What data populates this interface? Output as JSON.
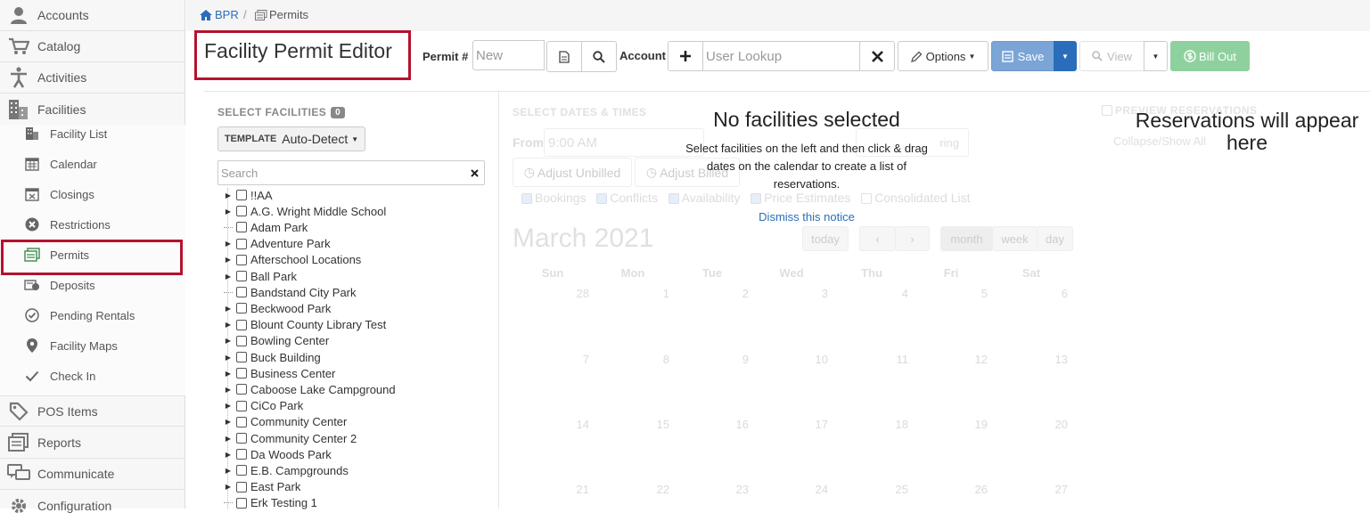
{
  "sidebar": {
    "main_items": [
      {
        "label": "Accounts",
        "icon": "user-icon"
      },
      {
        "label": "Catalog",
        "icon": "cart-icon"
      },
      {
        "label": "Activities",
        "icon": "person-icon"
      },
      {
        "label": "Facilities",
        "icon": "building-icon"
      }
    ],
    "sub_items": [
      {
        "label": "Facility List",
        "icon": "building-small-icon"
      },
      {
        "label": "Calendar",
        "icon": "calendar-icon"
      },
      {
        "label": "Closings",
        "icon": "calendar-x-icon"
      },
      {
        "label": "Restrictions",
        "icon": "x-circle-icon"
      },
      {
        "label": "Permits",
        "icon": "permit-icon"
      },
      {
        "label": "Deposits",
        "icon": "deposit-icon"
      },
      {
        "label": "Pending Rentals",
        "icon": "check-circle-icon"
      },
      {
        "label": "Facility Maps",
        "icon": "map-pin-icon"
      },
      {
        "label": "Check In",
        "icon": "check-icon"
      }
    ],
    "bottom_items": [
      {
        "label": "POS Items",
        "icon": "tag-icon"
      },
      {
        "label": "Reports",
        "icon": "report-icon"
      },
      {
        "label": "Communicate",
        "icon": "chat-icon"
      },
      {
        "label": "Configuration",
        "icon": "gear-icon"
      }
    ]
  },
  "breadcrumb": {
    "home": "BPR",
    "separator": "/",
    "current": "Permits"
  },
  "header": {
    "title": "Facility Permit Editor",
    "permit_label": "Permit #",
    "permit_placeholder": "New",
    "account_label": "Account",
    "account_placeholder": "User Lookup",
    "options_label": "Options",
    "save_label": "Save",
    "view_label": "View",
    "bill_out_label": "Bill Out"
  },
  "facilities": {
    "heading": "SELECT FACILITIES",
    "count": "0",
    "template_label": "TEMPLATE",
    "template_value": "Auto-Detect",
    "search_placeholder": "Search",
    "items": [
      {
        "name": "!!AA",
        "expandable": true
      },
      {
        "name": "A.G. Wright Middle School",
        "expandable": true
      },
      {
        "name": "Adam Park",
        "expandable": false
      },
      {
        "name": "Adventure Park",
        "expandable": true
      },
      {
        "name": "Afterschool Locations",
        "expandable": true
      },
      {
        "name": "Ball Park",
        "expandable": true
      },
      {
        "name": "Bandstand City Park",
        "expandable": false
      },
      {
        "name": "Beckwood Park",
        "expandable": true
      },
      {
        "name": "Blount County Library Test",
        "expandable": true
      },
      {
        "name": "Bowling Center",
        "expandable": true
      },
      {
        "name": "Buck Building",
        "expandable": true
      },
      {
        "name": "Business Center",
        "expandable": true
      },
      {
        "name": "Caboose Lake Campground",
        "expandable": true
      },
      {
        "name": "CiCo Park",
        "expandable": true
      },
      {
        "name": "Community Center",
        "expandable": true
      },
      {
        "name": "Community Center 2",
        "expandable": true
      },
      {
        "name": "Da Woods Park",
        "expandable": true
      },
      {
        "name": "E.B. Campgrounds",
        "expandable": true
      },
      {
        "name": "East Park",
        "expandable": true
      },
      {
        "name": "Erk Testing 1",
        "expandable": false
      }
    ]
  },
  "notice": {
    "title": "No facilities selected",
    "body": "Select facilities on the left and then click & drag dates on the calendar to create a list of reservations.",
    "dismiss": "Dismiss this notice"
  },
  "calendar": {
    "heading": "SELECT DATES & TIMES",
    "from_label": "From",
    "from_value": "9:00 AM",
    "recurring_label": "ring",
    "adjust_unbilled": "Adjust Unbilled",
    "adjust_billed": "Adjust Billed",
    "filters": [
      "Bookings",
      "Conflicts",
      "Availability",
      "Price Estimates",
      "Consolidated List"
    ],
    "month_title": "March 2021",
    "today_label": "today",
    "view_month": "month",
    "view_week": "week",
    "view_day": "day",
    "weekdays": [
      "Sun",
      "Mon",
      "Tue",
      "Wed",
      "Thu",
      "Fri",
      "Sat"
    ],
    "weeks": [
      [
        "28",
        "1",
        "2",
        "3",
        "4",
        "5",
        "6"
      ],
      [
        "7",
        "8",
        "9",
        "10",
        "11",
        "12",
        "13"
      ],
      [
        "14",
        "15",
        "16",
        "17",
        "18",
        "19",
        "20"
      ],
      [
        "21",
        "22",
        "23",
        "24",
        "25",
        "26",
        "27"
      ]
    ]
  },
  "reservations": {
    "heading": "PREVIEW RESERVATIONS",
    "collapse": "Collapse/Show All",
    "empty_line1": "Reservations will appear",
    "empty_line2": "here"
  },
  "colors": {
    "accent": "#2a6ebb",
    "highlight_border": "#b5122e",
    "save": "#7aa5d6",
    "bill_out": "#8fd19e"
  }
}
